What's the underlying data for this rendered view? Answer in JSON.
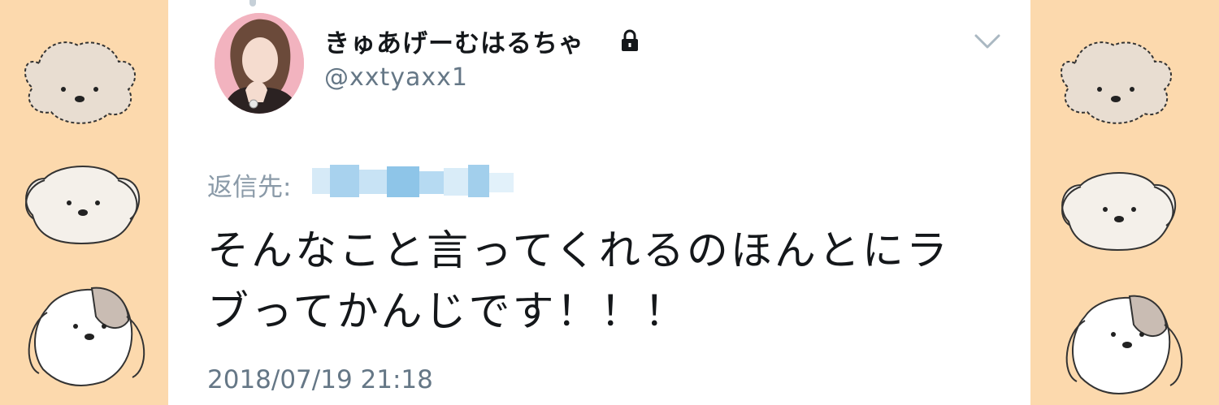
{
  "tweet": {
    "display_name": "きゅあげーむはるちゃ",
    "handle": "@xxtyaxx1",
    "reply_label": "返信先:",
    "text_line1": "そんなこと言ってくれるのほんとにラ",
    "text_line2": "ブってかんじです！！！",
    "timestamp": "2018/07/19 21:18"
  },
  "icons": {
    "lock": "lock-icon",
    "chevron": "chevron-down-icon"
  },
  "colors": {
    "background": "#fcd9ad",
    "card": "#ffffff",
    "name_text": "#14171a",
    "secondary_text": "#657786",
    "accent_blur": "#8ec5e8"
  }
}
